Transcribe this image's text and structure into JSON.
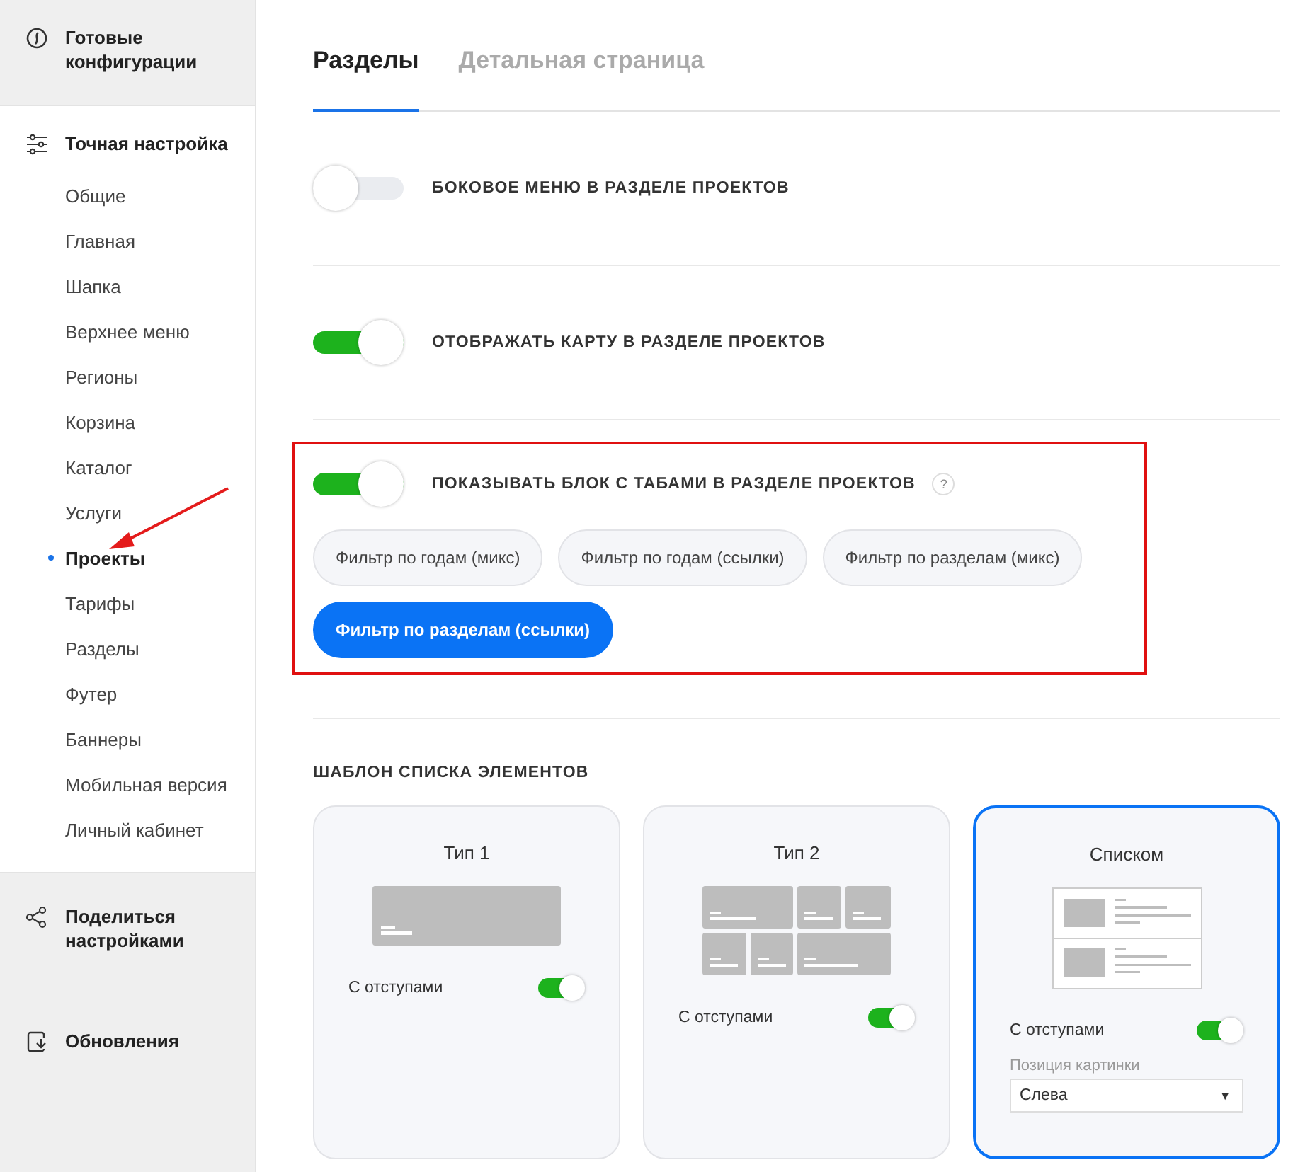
{
  "sidebar": {
    "sections": [
      {
        "kind": "link",
        "label": "Готовые конфигурации"
      },
      {
        "kind": "group",
        "label": "Точная настройка",
        "items": [
          {
            "label": "Общие",
            "selected": false
          },
          {
            "label": "Главная",
            "selected": false
          },
          {
            "label": "Шапка",
            "selected": false
          },
          {
            "label": "Верхнее меню",
            "selected": false
          },
          {
            "label": "Регионы",
            "selected": false
          },
          {
            "label": "Корзина",
            "selected": false
          },
          {
            "label": "Каталог",
            "selected": false
          },
          {
            "label": "Услуги",
            "selected": false
          },
          {
            "label": "Проекты",
            "selected": true
          },
          {
            "label": "Тарифы",
            "selected": false
          },
          {
            "label": "Разделы",
            "selected": false
          },
          {
            "label": "Футер",
            "selected": false
          },
          {
            "label": "Баннеры",
            "selected": false
          },
          {
            "label": "Мобильная версия",
            "selected": false
          },
          {
            "label": "Личный кабинет",
            "selected": false
          }
        ]
      },
      {
        "kind": "link",
        "label": "Поделиться настройками"
      },
      {
        "kind": "link",
        "label": "Обновления"
      }
    ]
  },
  "tabs": [
    {
      "label": "Разделы",
      "selected": true
    },
    {
      "label": "Детальная страница",
      "selected": false
    }
  ],
  "settings": [
    {
      "label": "БОКОВОЕ МЕНЮ В РАЗДЕЛЕ ПРОЕКТОВ",
      "on": false,
      "highlighted": false
    },
    {
      "label": "ОТОБРАЖАТЬ КАРТУ В РАЗДЕЛЕ ПРОЕКТОВ",
      "on": true,
      "highlighted": false
    },
    {
      "label": "ПОКАЗЫВАТЬ БЛОК С ТАБАМИ В РАЗДЕЛЕ ПРОЕКТОВ",
      "on": true,
      "highlighted": true,
      "help": "?",
      "options": [
        {
          "label": "Фильтр по годам (микс)",
          "selected": false
        },
        {
          "label": "Фильтр по годам (ссылки)",
          "selected": false
        },
        {
          "label": "Фильтр по разделам (микс)",
          "selected": false
        },
        {
          "label": "Фильтр по разделам (ссылки)",
          "selected": true
        }
      ]
    }
  ],
  "template_section": {
    "title": "ШАБЛОН СПИСКА ЭЛЕМЕНТОВ",
    "templates": [
      {
        "title": "Тип 1",
        "kind": "wide",
        "selected": false,
        "option": {
          "label": "С отступами",
          "on": true
        }
      },
      {
        "title": "Тип 2",
        "kind": "grid",
        "selected": false,
        "option": {
          "label": "С отступами",
          "on": true
        }
      },
      {
        "title": "Списком",
        "kind": "list",
        "selected": true,
        "option": {
          "label": "С отступами",
          "on": true
        },
        "image_position": {
          "label": "Позиция картинки",
          "value": "Слева",
          "caret": "▼"
        }
      }
    ]
  }
}
